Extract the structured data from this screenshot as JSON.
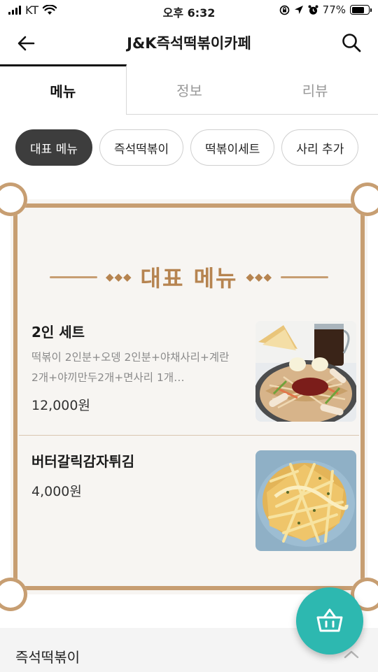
{
  "status_bar": {
    "carrier": "KT",
    "time": "오후 6:32",
    "battery": "77%",
    "battery_level": 0.77,
    "icons": [
      "signal-icon",
      "wifi-icon",
      "orientation-lock-icon",
      "location-icon",
      "alarm-icon",
      "battery-icon"
    ]
  },
  "header": {
    "title": "J&K즉석떡볶이카페",
    "icons": [
      "back-arrow-icon",
      "search-icon"
    ]
  },
  "tabs": [
    {
      "label": "메뉴",
      "active": true
    },
    {
      "label": "정보",
      "active": false
    },
    {
      "label": "리뷰",
      "active": false
    }
  ],
  "chips": [
    {
      "label": "대표 메뉴",
      "active": true
    },
    {
      "label": "즉석떡볶이",
      "active": false
    },
    {
      "label": "떡볶이세트",
      "active": false
    },
    {
      "label": "사리 추가",
      "active": false
    }
  ],
  "featured": {
    "title": "대표 메뉴",
    "items": [
      {
        "name": "2인 세트",
        "description": "떡볶이 2인분+오뎅 2인분+야채사리+계란 2개+야끼만두2개+면사리 1개…",
        "price": "12,000원"
      },
      {
        "name": "버터갈릭감자튀김",
        "description": "",
        "price": "4,000원"
      }
    ]
  },
  "bottom_section": {
    "label": "즉석떡볶이",
    "icon": "chevron-up-icon"
  },
  "fab": {
    "icon": "shopping-basket-icon"
  },
  "colors": {
    "accent_gold": "#c79e72",
    "title_gold": "#b68450",
    "fab_teal": "#2db8b0",
    "chip_active": "#3d3d3d"
  }
}
